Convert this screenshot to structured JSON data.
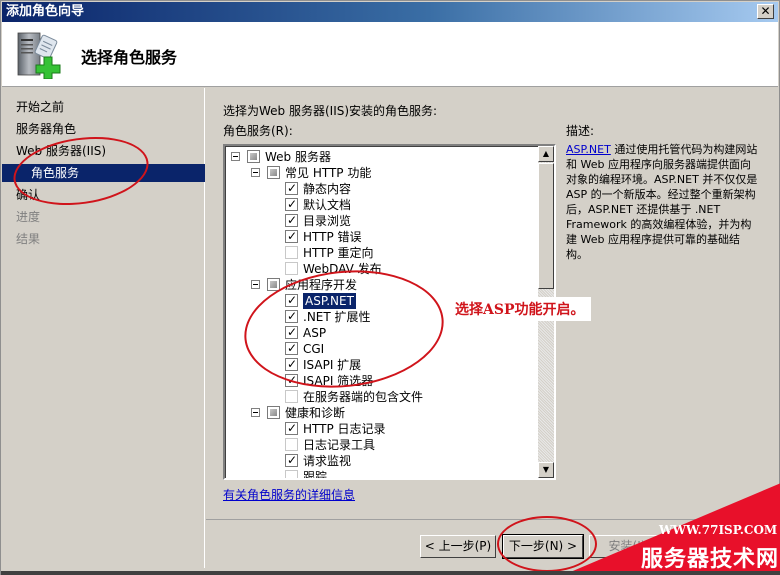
{
  "window": {
    "title": "添加角色向导",
    "close_label": "✕"
  },
  "header": {
    "title": "选择角色服务",
    "icon": "server-add-icon"
  },
  "sidebar": {
    "items": [
      {
        "label": "开始之前",
        "state": "normal"
      },
      {
        "label": "服务器角色",
        "state": "normal"
      },
      {
        "label": "Web 服务器(IIS)",
        "state": "normal"
      },
      {
        "label": "角色服务",
        "state": "selected"
      },
      {
        "label": "确认",
        "state": "normal"
      },
      {
        "label": "进度",
        "state": "disabled"
      },
      {
        "label": "结果",
        "state": "disabled"
      }
    ]
  },
  "main": {
    "instruction": "选择为Web 服务器(IIS)安装的角色服务:",
    "roles_label": "角色服务(R):",
    "tree": [
      {
        "label": "Web 服务器",
        "level": 0,
        "state": "partial",
        "expandable": true
      },
      {
        "label": "常见 HTTP 功能",
        "level": 1,
        "state": "partial",
        "expandable": true
      },
      {
        "label": "静态内容",
        "level": 2,
        "state": "checked"
      },
      {
        "label": "默认文档",
        "level": 2,
        "state": "checked"
      },
      {
        "label": "目录浏览",
        "level": 2,
        "state": "checked"
      },
      {
        "label": "HTTP 错误",
        "level": 2,
        "state": "checked"
      },
      {
        "label": "HTTP 重定向",
        "level": 2,
        "state": "unchecked"
      },
      {
        "label": "WebDAV 发布",
        "level": 2,
        "state": "unchecked"
      },
      {
        "label": "应用程序开发",
        "level": 1,
        "state": "partial",
        "expandable": true
      },
      {
        "label": "ASP.NET",
        "level": 2,
        "state": "checked",
        "selected": true
      },
      {
        "label": ".NET 扩展性",
        "level": 2,
        "state": "checked"
      },
      {
        "label": "ASP",
        "level": 2,
        "state": "checked"
      },
      {
        "label": "CGI",
        "level": 2,
        "state": "checked"
      },
      {
        "label": "ISAPI 扩展",
        "level": 2,
        "state": "checked"
      },
      {
        "label": "ISAPI 筛选器",
        "level": 2,
        "state": "checked"
      },
      {
        "label": "在服务器端的包含文件",
        "level": 2,
        "state": "unchecked"
      },
      {
        "label": "健康和诊断",
        "level": 1,
        "state": "partial",
        "expandable": true
      },
      {
        "label": "HTTP 日志记录",
        "level": 2,
        "state": "checked"
      },
      {
        "label": "日志记录工具",
        "level": 2,
        "state": "unchecked"
      },
      {
        "label": "请求监视",
        "level": 2,
        "state": "checked"
      },
      {
        "label": "跟踪",
        "level": 2,
        "state": "unchecked"
      }
    ],
    "more_info_link": "有关角色服务的详细信息",
    "description_label": "描述:",
    "description_link": "ASP.NET",
    "description_text": " 通过使用托管代码为构建网站和 Web 应用程序向服务器端提供面向对象的编程环境。ASP.NET 并不仅仅是 ASP 的一个新版本。经过整个重新架构后，ASP.NET 还提供基于 .NET Framework 的高效编程体验，并为构建 Web 应用程序提供可靠的基础结构。"
  },
  "footer": {
    "prev_label": "< 上一步(P)",
    "next_label": "下一步(N) >",
    "install_label": "安装(I)"
  },
  "annotation": {
    "text": "选择ASP功能开启。",
    "color": "#d0141b"
  },
  "watermark": {
    "url": "WWW.77ISP.COM",
    "name": "服务器技术网",
    "color": "#e8102a"
  }
}
